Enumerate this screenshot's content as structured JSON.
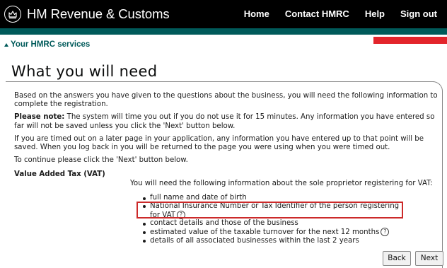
{
  "header": {
    "brand_name": "HM Revenue & Customs",
    "nav": [
      "Home",
      "Contact HMRC",
      "Help",
      "Sign out"
    ]
  },
  "services_link": "Your HMRC services",
  "page_title": "What you will need",
  "intro": "Based on the answers you have given to the questions about the business, you will need the following information to complete the registration.",
  "note_label": "Please note:",
  "note_text": "The system will time you out if you do not use it for 15 minutes. Any information you have entered so far will not be saved unless you click the 'Next' button below.",
  "timeout_text": "If you are timed out on a later page in your application, any information you have entered up to that point will be saved. When you log back in you will be returned to the page you were using when you were timed out.",
  "continue_text": "To continue please click the 'Next' button below.",
  "vat": {
    "heading": "Value Added Tax (VAT)",
    "intro": "You will need the following information about the sole proprietor registering for VAT:",
    "items": [
      "full name and date of birth",
      "National Insurance Number or Tax Identifier of the person registering for VAT",
      "contact details and those of the business",
      "estimated value of the taxable turnover for the next 12 months",
      "details of all associated businesses within the last 2 years"
    ]
  },
  "help_glyph": "?",
  "buttons": {
    "back": "Back",
    "next": "Next"
  },
  "colors": {
    "header_bg": "#000000",
    "brand_teal": "#005a5a",
    "accent_red": "#e3242b",
    "highlight": "#cc2a2a"
  },
  "icons": {
    "crest": "royal-crest-icon",
    "services": "triangle-up-icon",
    "help": "question-circle-icon"
  }
}
